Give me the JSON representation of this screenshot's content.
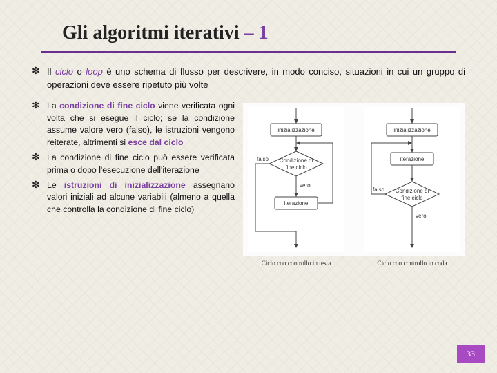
{
  "title_prefix": "Gli algoritmi iterativi ",
  "title_suffix": "– 1",
  "bullets": [
    {
      "pre": "Il ",
      "em1": "ciclo",
      "mid": " o ",
      "em2": "loop ",
      "post": " è uno schema di flusso per descrivere, in modo conciso, situazioni in cui un gruppo di operazioni deve essere ripetuto più volte"
    }
  ],
  "left_bullets": [
    {
      "p1": "La ",
      "s1": "condizione di fine ciclo",
      "p2": " viene verificata ogni volta che si esegue il ciclo; se la condizione assume valore vero (falso), le istruzioni vengono reiterate, altrimenti si ",
      "s2": "esce dal ciclo",
      "p3": ""
    },
    {
      "p1": "La condizione di fine ciclo può essere verificata prima o dopo l'esecuzione dell'iterazione",
      "s1": "",
      "p2": "",
      "s2": "",
      "p3": ""
    },
    {
      "p1": "Le ",
      "s1": "istruzioni di inizializzazione",
      "p2": " assegnano valori iniziali ad alcune variabili (almeno a quella che controlla la condizione di fine ciclo)",
      "s2": "",
      "p3": ""
    }
  ],
  "diagram_labels": {
    "init": "inizializzazione",
    "cond1": "Condizione di",
    "cond2": "fine ciclo",
    "iter": "iterazione",
    "falso": "falso",
    "vero": "vero"
  },
  "captions": {
    "left": "Ciclo con controllo in testa",
    "right": "Ciclo con controllo in coda"
  },
  "page": "33"
}
